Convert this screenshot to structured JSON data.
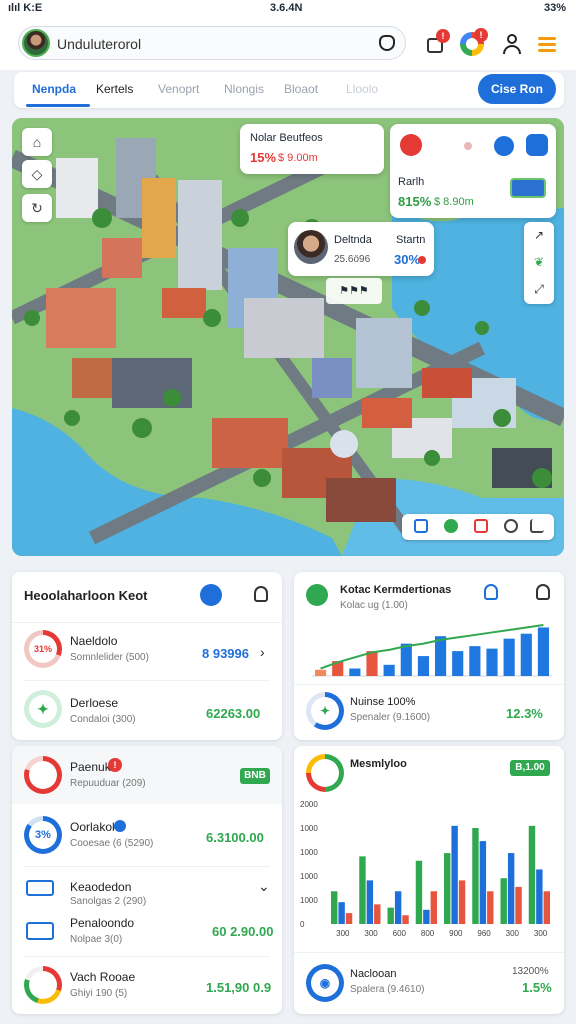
{
  "status": {
    "left": "ılıl K:E",
    "center": "3.6.4N",
    "right": "33%"
  },
  "search": {
    "text": "Unduluterorol"
  },
  "tabs": [
    {
      "label": "Nenpda",
      "active": true
    },
    {
      "label": "Kertels",
      "active": false
    },
    {
      "label": "Venoprt",
      "active": false
    },
    {
      "label": "Nlongis",
      "active": false
    },
    {
      "label": "Bloaot",
      "active": false
    },
    {
      "label": "Lloolo",
      "active": false
    }
  ],
  "cta": {
    "label": "Cise Ron"
  },
  "map": {
    "overlay1": {
      "title": "Nolar Beutfeos",
      "value": "15%",
      "sub": "$ 9.00m"
    },
    "overlay2": {
      "title": "Rarlh",
      "value": "815%",
      "sub": "$ 8.90m"
    },
    "overlay3": {
      "title": "Deltnda",
      "title2": "Startn",
      "value": "25.6ö96",
      "value2": "30%"
    },
    "pin": "⚑⚑⚑"
  },
  "card1": {
    "title": "Heoolaharloon Keot",
    "rows": [
      {
        "label": "Naeldolo",
        "sub": "Somnlelider (500)",
        "value": "8 93996",
        "ring": "31%"
      },
      {
        "label": "Derloese",
        "sub": "Condaloi (300)",
        "value": "62263.00",
        "ring": ""
      }
    ]
  },
  "card2": {
    "title": "Kotac Kermdertionas",
    "subtitle": "Kolac ug (1.00)",
    "row": {
      "label": "Nuinse 100%",
      "sub": "Spenaler (9.1600)",
      "value": "12.3%"
    }
  },
  "card3": {
    "rows": [
      {
        "label": "Paenuk",
        "sub": "Repuuduar (209)",
        "value": "",
        "tag": "BNB"
      },
      {
        "label": "Oorlakok",
        "sub": "Cooesae (6 (5290)",
        "value": "6.3100.00",
        "ring": "3%"
      },
      {
        "label": "Keaodedon",
        "sub": "Sanolgas 2 (290)",
        "value": ""
      },
      {
        "label": "Penaloondo",
        "sub": "Nolpae 3(0)",
        "value": "60 2.90.00"
      },
      {
        "label": "Vach Rooae",
        "sub": "Ghiyi 190 (5)",
        "value": "1.51,90 0.9"
      }
    ]
  },
  "card4": {
    "title": "Mesmlyloo",
    "tag": "B,1.00",
    "row": {
      "label": "Naclooan",
      "sub": "Spalera (9.4610)",
      "value": "1.5%",
      "value_top": "13200%"
    }
  },
  "chart_data": [
    {
      "type": "bar",
      "title": "Kotac Kermdertionas",
      "categories": [
        "1",
        "2",
        "3",
        "4",
        "5",
        "6",
        "7",
        "8",
        "9",
        "10",
        "11",
        "12",
        "13",
        "14"
      ],
      "series": [
        {
          "values": [
            0.5,
            1.2,
            0.6,
            2.0,
            0.9,
            2.6,
            1.6,
            3.2,
            2.0,
            2.4,
            2.2,
            3.0,
            3.4,
            3.9
          ]
        }
      ],
      "trend": [
        0.6,
        1.1,
        1.5,
        1.9,
        2.1,
        2.4,
        2.6,
        2.9,
        3.1,
        3.3,
        3.5,
        3.7,
        3.9,
        4.1
      ],
      "ylim": [
        0,
        4.5
      ]
    },
    {
      "type": "bar",
      "title": "Mesmlyloo",
      "categories": [
        "300",
        "300",
        "600",
        "800",
        "900",
        "960",
        "300",
        "300"
      ],
      "yticks": [
        "2000",
        "1000",
        "1000",
        "1000",
        "1000",
        "0"
      ],
      "series": [
        {
          "values": [
            300,
            620,
            150,
            580,
            650,
            880,
            420,
            900
          ]
        },
        {
          "values": [
            200,
            400,
            300,
            130,
            900,
            760,
            650,
            500
          ]
        },
        {
          "values": [
            100,
            180,
            80,
            300,
            400,
            300,
            340,
            300
          ]
        }
      ],
      "ylim": [
        0,
        1100
      ]
    }
  ]
}
